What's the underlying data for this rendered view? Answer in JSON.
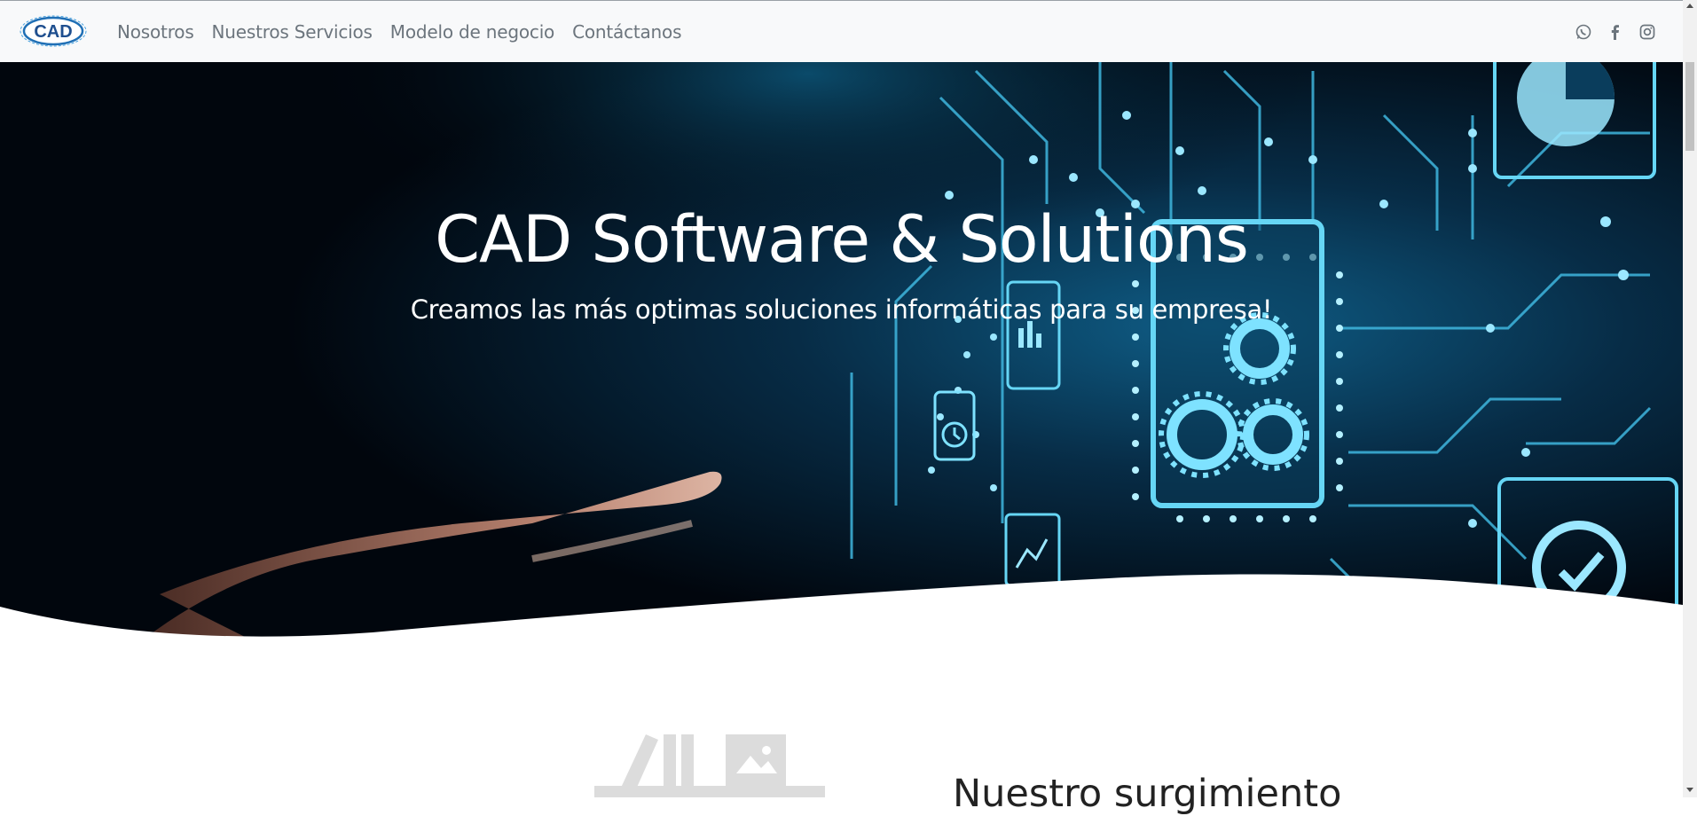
{
  "navbar": {
    "brand_logo_text": "CAD",
    "links": [
      "Nosotros",
      "Nuestros Servicios",
      "Modelo de negocio",
      "Contáctanos"
    ],
    "social": [
      "whatsapp-icon",
      "facebook-icon",
      "instagram-icon"
    ]
  },
  "hero": {
    "title": "CAD Software & Solutions",
    "subtitle": "Creamos las más optimas soluciones informáticas para su empresa!"
  },
  "about": {
    "title": "Nuestro surgimiento"
  },
  "colors": {
    "navbar_bg": "#f8f9fa",
    "nav_link": "#6c757d",
    "hero_bg": "#01060d",
    "circuit_cyan": "#5fd0f0"
  }
}
